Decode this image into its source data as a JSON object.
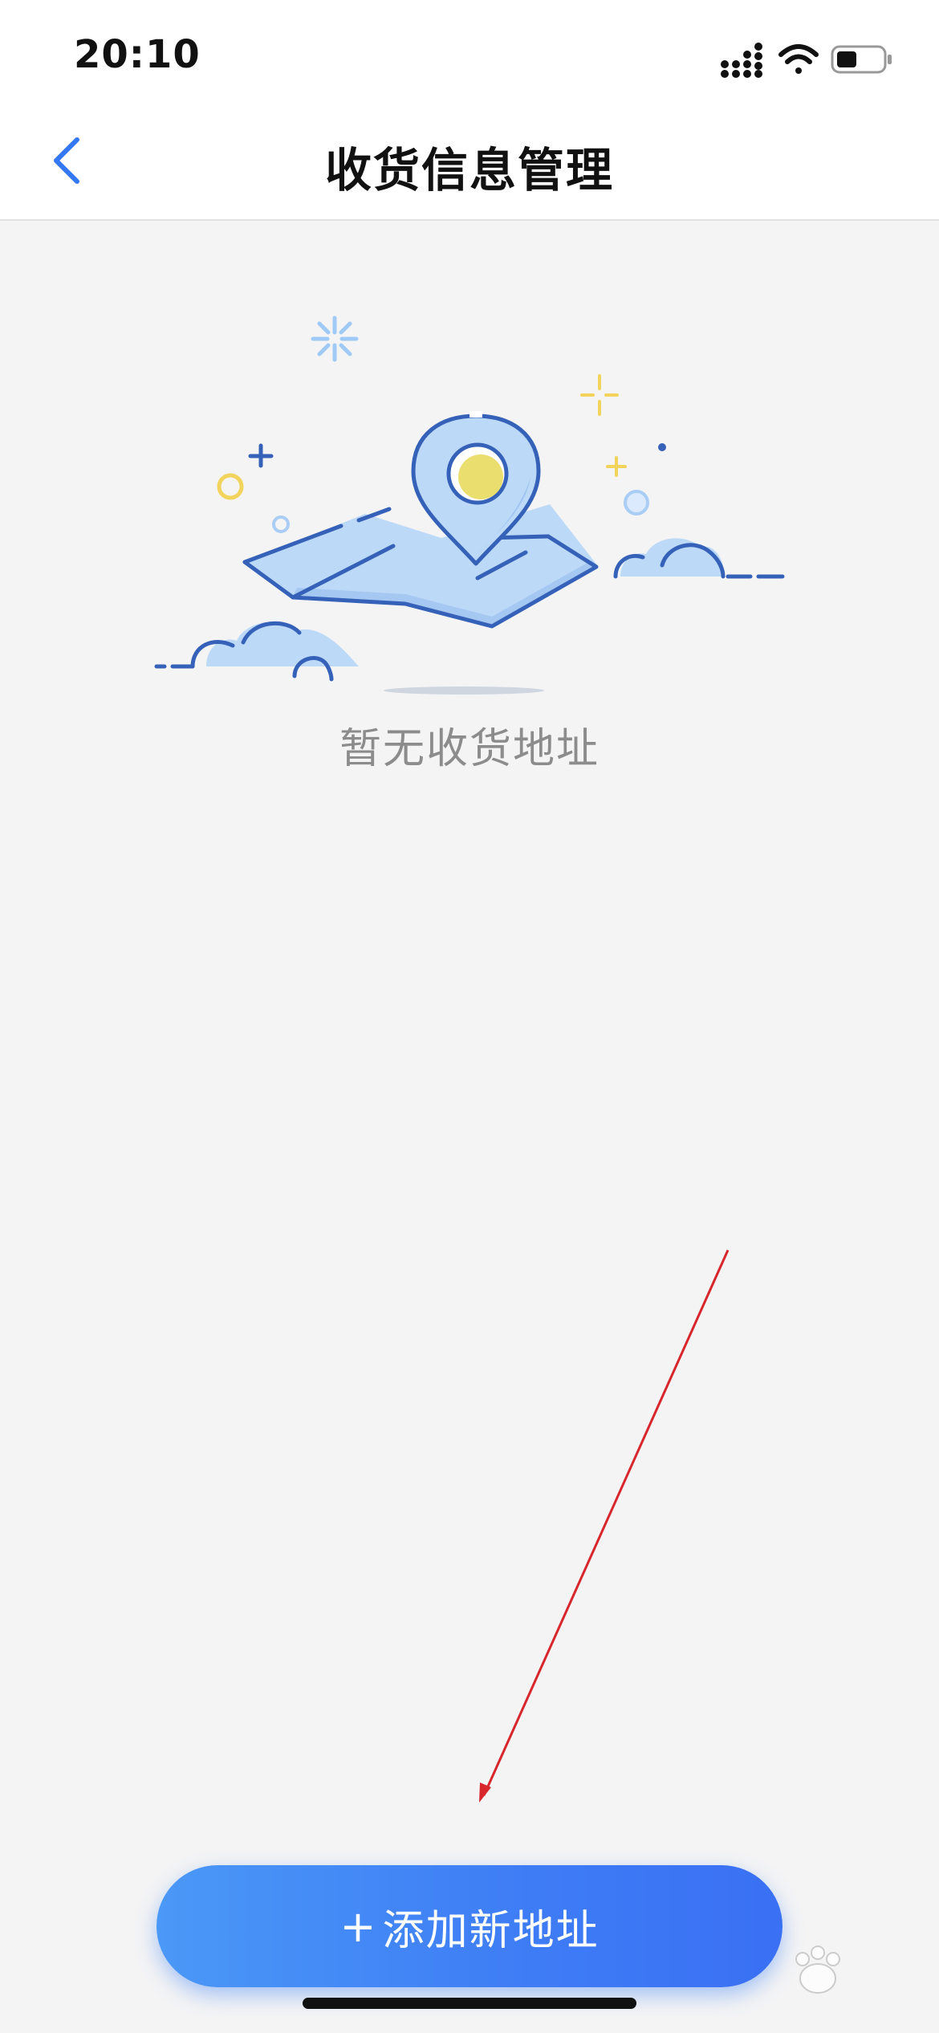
{
  "status_bar": {
    "time": "20:10",
    "icons": [
      "cellular-signal-icon",
      "wifi-icon",
      "battery-icon"
    ]
  },
  "header": {
    "back_icon": "chevron-left-icon",
    "title": "收货信息管理"
  },
  "empty_state": {
    "illustration": "map-location-pin-illustration",
    "message": "暂无收货地址"
  },
  "footer": {
    "add_button_plus": "+",
    "add_button_label": "添加新地址"
  },
  "colors": {
    "accent_blue": "#3e7cf5",
    "back_arrow_blue": "#3478f6",
    "illustration_blue_light": "#bcd9f8",
    "illustration_blue_stroke": "#3562b8",
    "illustration_yellow": "#f2d45c",
    "annotation_red": "#d7262c",
    "background": "#f4f4f5"
  }
}
